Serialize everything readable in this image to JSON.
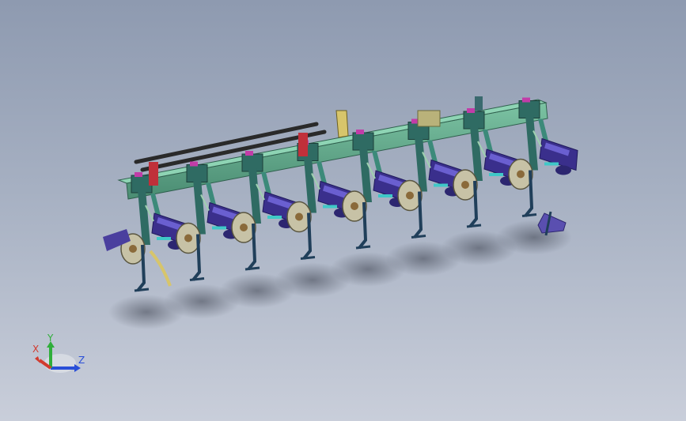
{
  "viewport": {
    "background_top": "#8e9ab0",
    "background_bottom": "#c9ceda"
  },
  "model": {
    "colors": {
      "main_beam": "#5fa88a",
      "frame": "#2f6b63",
      "cylinder": "#3a2f8c",
      "disc": "#c7c2a6",
      "bracket_red": "#c0303a",
      "rail": "#2a2a2a",
      "shank": "#203f5a",
      "accent": "#d7c56b"
    },
    "row_units": 8
  },
  "triad": {
    "x_label": "X",
    "y_label": "Y",
    "z_label": "Z",
    "x_color": "#d13a2e",
    "y_color": "#2fae3a",
    "z_color": "#2a4fd8"
  }
}
